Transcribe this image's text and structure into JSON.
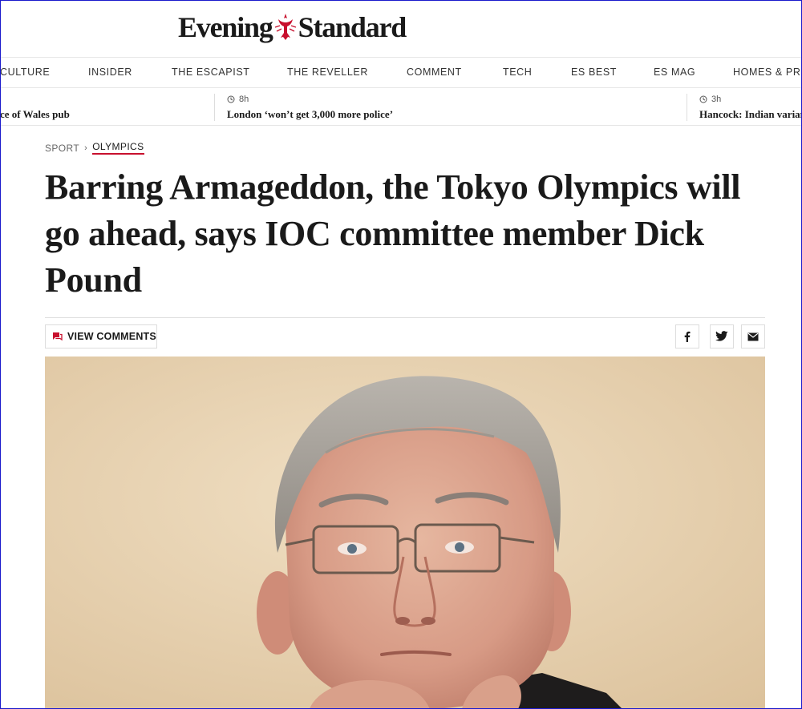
{
  "masthead": {
    "logo_left": "Evening",
    "logo_right": "Standard",
    "crest_icon": "eagle-crest-icon"
  },
  "nav": {
    "items": [
      "CULTURE",
      "INSIDER",
      "THE ESCAPIST",
      "THE REVELLER",
      "COMMENT",
      "TECH",
      "ES BEST",
      "ES MAG",
      "HOMES & PRO"
    ]
  },
  "ticker": {
    "items": [
      {
        "time": "",
        "headline": "ce of Wales pub"
      },
      {
        "time": "8h",
        "headline": "London ‘won’t get 3,000 more police’"
      },
      {
        "time": "3h",
        "headline": "Hancock: Indian varian"
      }
    ]
  },
  "breadcrumb": {
    "section": "SPORT",
    "separator": "›",
    "subsection": "OLYMPICS"
  },
  "article": {
    "title": "Barring Armageddon, the Tokyo Olympics will go ahead, says IOC committee member Dick Pound"
  },
  "toolbar": {
    "comments_label": "VIEW COMMENTS",
    "comments_icon": "comment-icon",
    "share_icons": [
      "facebook-icon",
      "twitter-icon",
      "email-icon"
    ]
  },
  "colors": {
    "accent": "#c8102e",
    "text": "#1a1a1a",
    "divider": "#e6e6e6",
    "photo_background": "#e9d6b8"
  }
}
